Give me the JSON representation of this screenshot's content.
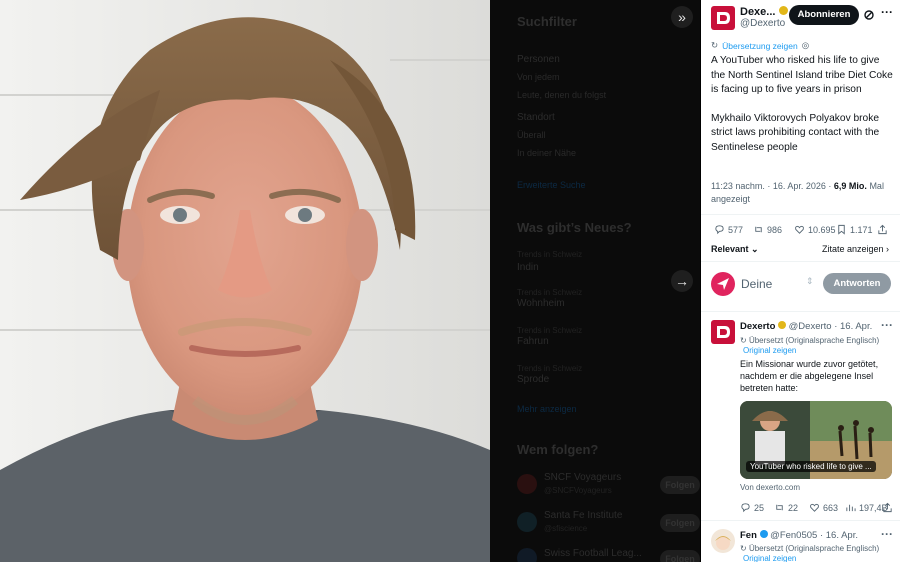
{
  "background": {
    "filter_title": "Suchfilter",
    "people_label": "Personen",
    "people_opt1": "Von jedem",
    "people_opt2": "Leute, denen du folgst",
    "location_label": "Standort",
    "location_opt1": "Überall",
    "location_opt2": "In deiner Nähe",
    "advanced_link": "Erweiterte Suche",
    "news_title": "Was gibt’s Neues?",
    "trends": [
      {
        "context": "Trends in Schweiz",
        "name": "Indin"
      },
      {
        "context": "Trends in Schweiz",
        "name": "Wohnheim"
      },
      {
        "context": "Trends in Schweiz",
        "name": "Fahrun"
      },
      {
        "context": "Trends in Schweiz",
        "name": "Sprode"
      }
    ],
    "show_more": "Mehr anzeigen",
    "follow_title": "Wem folgen?",
    "suggestions": [
      {
        "name": "SNCF Voyageurs",
        "handle": "@SNCFVoyageurs",
        "button": "Folgen"
      },
      {
        "name": "Santa Fe Institute",
        "handle": "@sfiscience",
        "button": "Folgen"
      },
      {
        "name": "Swiss Football Leag...",
        "handle": "",
        "button": "Folgen"
      }
    ]
  },
  "tweet": {
    "author_name": "Dexe...",
    "author_handle": "@Dexerto",
    "follow_button": "Abonnieren",
    "more_icon": "more-icon",
    "translation_link": "Übersetzung zeigen",
    "text_para1": "A YouTuber who risked his life to give the North Sentinel Island tribe Diet Coke is facing up to five years in prison",
    "text_para2": "Mykhailo Viktorovych Polyakov broke strict laws prohibiting contact with the Sentinelese people",
    "timestamp": "11:23 nachm. · 16. Apr. 2026 · ",
    "views_count": "6,9 Mio.",
    "views_label": " Mal angezeigt",
    "replies": "577",
    "retweets": "986",
    "likes": "10.695",
    "bookmarks": "1.171",
    "sort_label": "Relevant",
    "quotes_link": "Zitate anzeigen"
  },
  "reply_box": {
    "placeholder": "Deine",
    "reply_button": "Antworten"
  },
  "replies": [
    {
      "name": "Dexerto",
      "handle": "@Dexerto · 16. Apr.",
      "translated_note": "Übersetzt (Originalsprache Englisch)",
      "original_link": "Original zeigen",
      "text": "Ein Missionar wurde zuvor getötet, nachdem er die abgelegene Insel betreten hatte:",
      "card_caption": "YouTuber who risked life to give ...",
      "card_source": "Von dexerto.com",
      "replies": "25",
      "retweets": "22",
      "likes": "663",
      "views": "197,4B"
    },
    {
      "name": "Fen",
      "handle": "@Fen0505 · 16. Apr.",
      "translated_note": "Übersetzt (Originalsprache Englisch)",
      "original_link": "Original zeigen"
    }
  ],
  "colors": {
    "accent": "#1d9bf0",
    "verified_gold": "#e2b719",
    "dexerto_brand": "#c8103a"
  }
}
